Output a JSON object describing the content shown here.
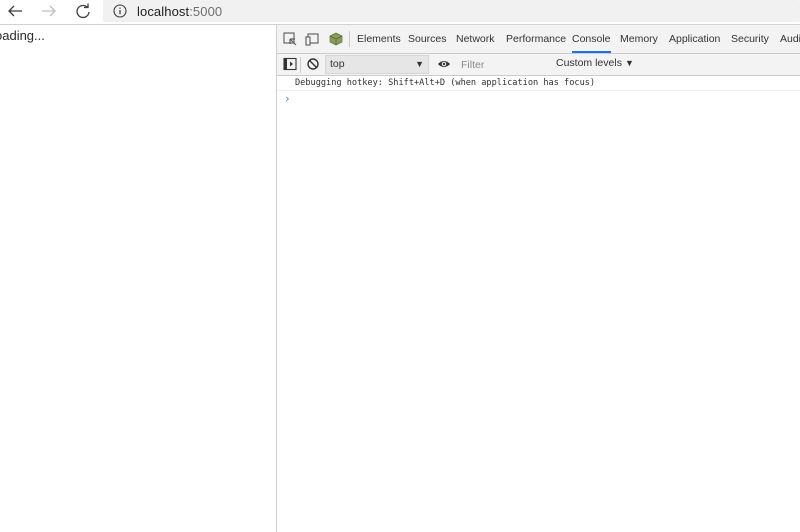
{
  "browser": {
    "url_host": "localhost",
    "url_port": ":5000"
  },
  "page": {
    "loading_text": "oading..."
  },
  "devtools": {
    "tabs": [
      {
        "label": "Elements",
        "active": false
      },
      {
        "label": "Sources",
        "active": false
      },
      {
        "label": "Network",
        "active": false
      },
      {
        "label": "Performance",
        "active": false
      },
      {
        "label": "Console",
        "active": true
      },
      {
        "label": "Memory",
        "active": false
      },
      {
        "label": "Application",
        "active": false
      },
      {
        "label": "Security",
        "active": false
      },
      {
        "label": "Audit",
        "active": false
      }
    ],
    "toolbar": {
      "context": "top",
      "filter_placeholder": "Filter",
      "levels": "Custom levels"
    },
    "console": {
      "lines": [
        "Debugging hotkey: Shift+Alt+D (when application has focus)"
      ],
      "prompt": "›"
    },
    "colors": {
      "active_tab_underline": "#1a73e8",
      "prompt": "#3a7bd5"
    }
  }
}
